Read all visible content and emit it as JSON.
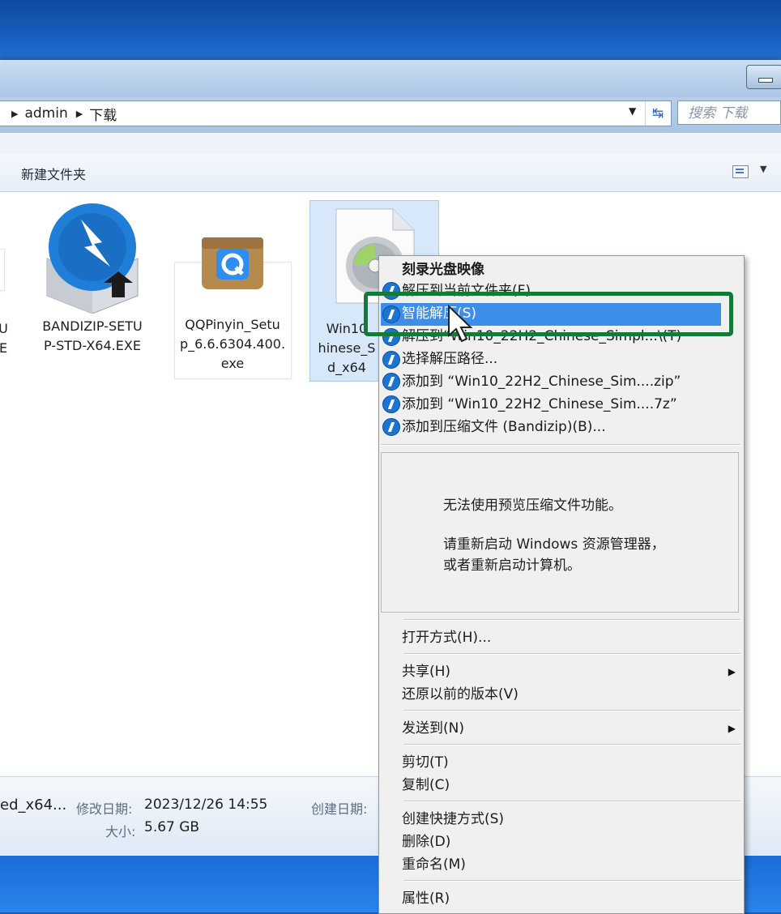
{
  "explorer": {
    "breadcrumb": [
      "admin",
      "下载"
    ],
    "search_placeholder": "搜索 下载",
    "toolbar": {
      "new_folder_label": "新建文件夹"
    },
    "files": [
      {
        "name_lines": [
          "U",
          "E"
        ]
      },
      {
        "name_lines": [
          "BANDIZIP-SETU",
          "P-STD-X64.EXE"
        ]
      },
      {
        "name_lines": [
          "QQPinyin_Setu",
          "p_6.6.6304.400.",
          "exe"
        ]
      },
      {
        "name_lines": [
          "Win10",
          "hinese_S",
          "d_x64"
        ]
      }
    ],
    "details": {
      "filename": "ed_x64...",
      "modified_label": "修改日期:",
      "modified_value": "2023/12/26 14:55",
      "created_label": "创建日期:",
      "size_label": "大小:",
      "size_value": "5.67 GB"
    }
  },
  "context_menu": {
    "header": "刻录光盘映像",
    "bandizip_items": [
      "解压到当前文件夹(F)",
      "智能解压(S)",
      "解压到“Win10_22H2_Chinese_Simpl...\\(T)",
      "选择解压路径...",
      "添加到 “Win10_22H2_Chinese_Sim....zip”",
      "添加到 “Win10_22H2_Chinese_Sim....7z”",
      "添加到压缩文件 (Bandizip)(B)..."
    ],
    "preview_line1": "无法使用预览压缩文件功能。",
    "preview_line2": "请重新启动 Windows 资源管理器，",
    "preview_line3": "或者重新启动计算机。",
    "open_with": "打开方式(H)...",
    "share": "共享(H)",
    "restore": "还原以前的版本(V)",
    "send_to": "发送到(N)",
    "cut": "剪切(T)",
    "copy": "复制(C)",
    "create_shortcut": "创建快捷方式(S)",
    "delete": "删除(D)",
    "rename": "重命名(M)",
    "properties": "属性(R)"
  },
  "colors": {
    "highlight": "#3d8ee8",
    "annotation_box": "#137a3a",
    "bandizip": "#1a74d2"
  }
}
